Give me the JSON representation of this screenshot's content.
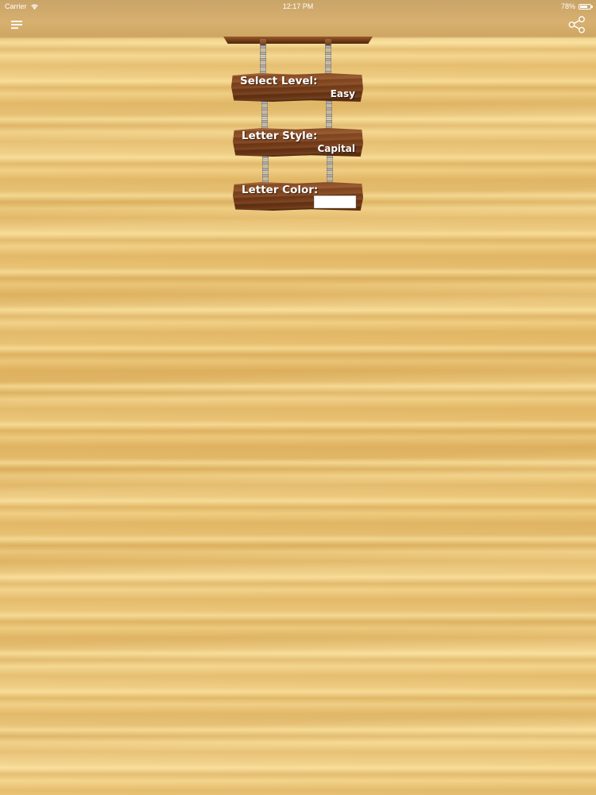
{
  "status_bar": {
    "carrier": "Carrier",
    "time": "12:17 PM",
    "battery": "78%",
    "battery_level": 0.78
  },
  "nav": {
    "menu_icon": "hamburger-menu-icon",
    "share_icon": "share-icon"
  },
  "settings": {
    "level": {
      "label": "Select Level:",
      "value": "Easy"
    },
    "letter_style": {
      "label": "Letter Style:",
      "value": "Capital"
    },
    "letter_color": {
      "label": "Letter Color:",
      "color": "#ffffff"
    }
  },
  "colors": {
    "wood_background": "#e8c274",
    "sign_wood": "#7a3f1a",
    "text": "#ffffff"
  }
}
